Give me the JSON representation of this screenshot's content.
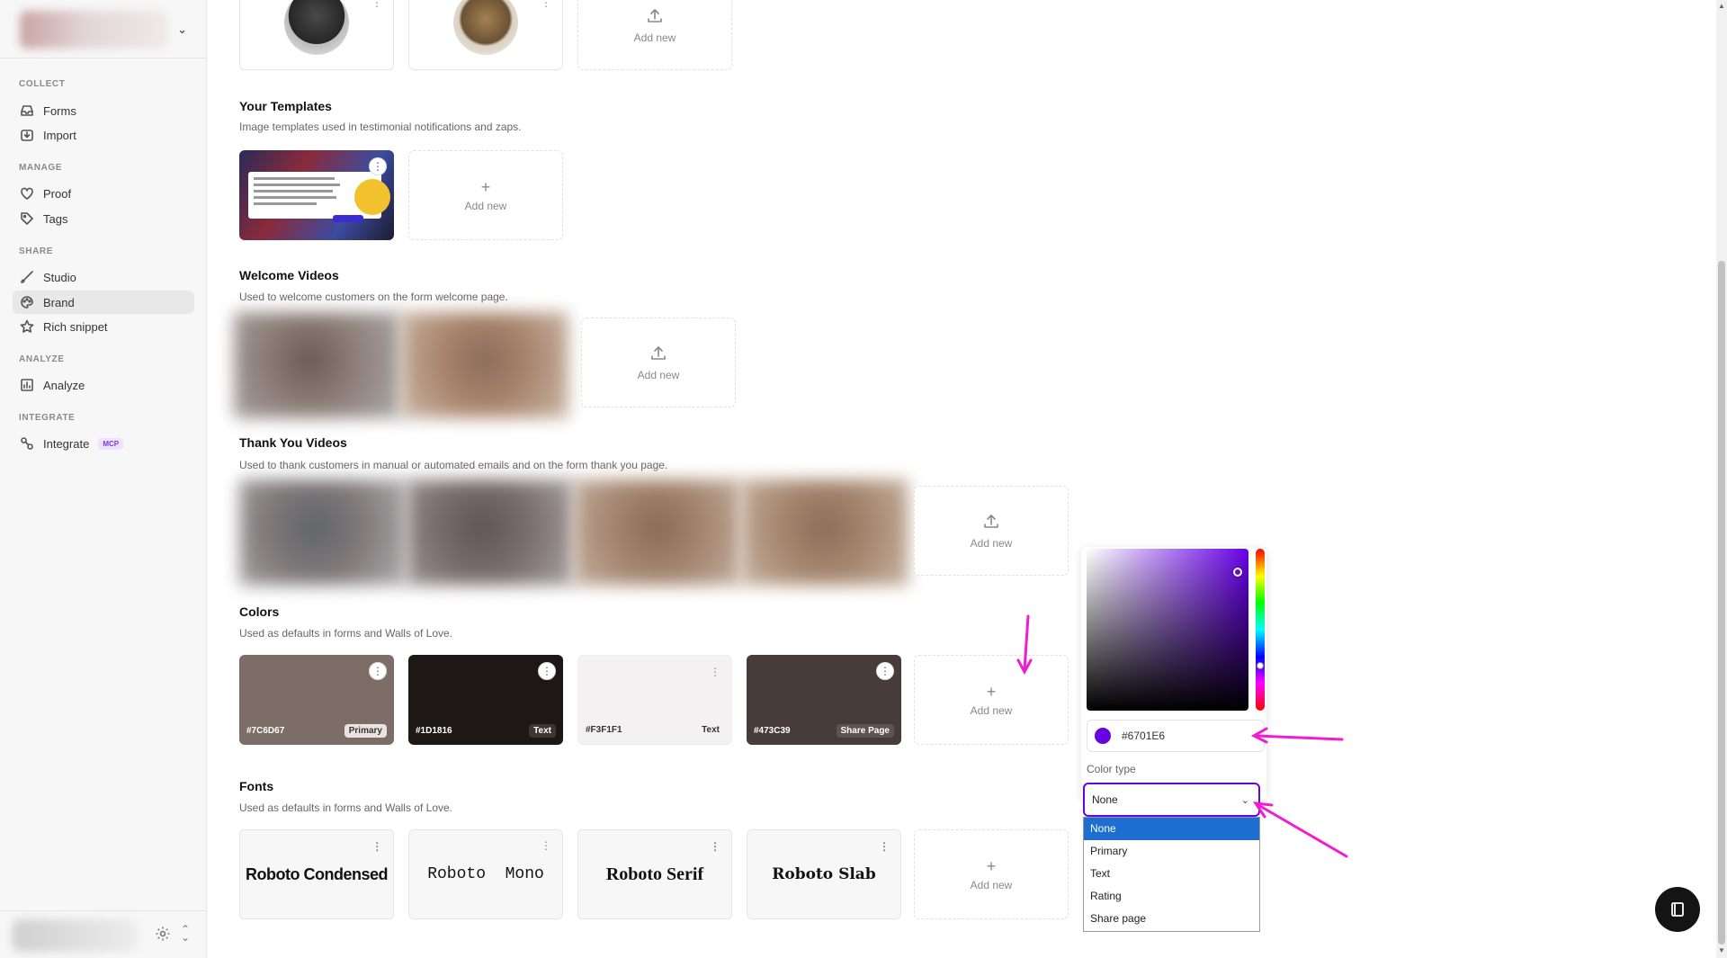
{
  "sidebar": {
    "sections": [
      {
        "label": "COLLECT",
        "items": [
          {
            "label": "Forms",
            "icon": "inbox-icon"
          },
          {
            "label": "Import",
            "icon": "import-icon"
          }
        ]
      },
      {
        "label": "MANAGE",
        "items": [
          {
            "label": "Proof",
            "icon": "heart-icon"
          },
          {
            "label": "Tags",
            "icon": "tag-icon"
          }
        ]
      },
      {
        "label": "SHARE",
        "items": [
          {
            "label": "Studio",
            "icon": "brush-icon"
          },
          {
            "label": "Brand",
            "icon": "palette-icon",
            "active": true
          },
          {
            "label": "Rich snippet",
            "icon": "star-icon"
          }
        ]
      },
      {
        "label": "ANALYZE",
        "items": [
          {
            "label": "Analyze",
            "icon": "chart-icon"
          }
        ]
      },
      {
        "label": "INTEGRATE",
        "items": [
          {
            "label": "Integrate",
            "icon": "plug-icon",
            "badge": "MCP"
          }
        ]
      }
    ]
  },
  "add_new_label": "Add new",
  "templates": {
    "title": "Your Templates",
    "subtitle": "Image templates used in testimonial notifications and zaps."
  },
  "welcome_videos": {
    "title": "Welcome Videos",
    "subtitle": "Used to welcome customers on the form welcome page."
  },
  "thank_you_videos": {
    "title": "Thank You Videos",
    "subtitle": "Used to thank customers in manual or automated emails and on the form thank you page."
  },
  "colors": {
    "title": "Colors",
    "subtitle": "Used as defaults in forms and Walls of Love.",
    "items": [
      {
        "hex": "#7C6D67",
        "type": "Primary",
        "bg": "#7c6d67",
        "fg": "#ffffff",
        "badge_bg": "#e9e4e2",
        "badge_fg": "#3a3330"
      },
      {
        "hex": "#1D1816",
        "type": "Text",
        "bg": "#1d1816",
        "fg": "#ffffff",
        "badge_bg": "#3c3532",
        "badge_fg": "#ffffff"
      },
      {
        "hex": "#F3F1F1",
        "type": "Text",
        "bg": "#f3f1f1",
        "fg": "#333333",
        "badge_bg": "#f3f1f1",
        "badge_fg": "#333333"
      },
      {
        "hex": "#473C39",
        "type": "Share Page",
        "bg": "#473c39",
        "fg": "#ffffff",
        "badge_bg": "#5e5350",
        "badge_fg": "#ffffff"
      }
    ]
  },
  "fonts": {
    "title": "Fonts",
    "subtitle": "Used as defaults in forms and Walls of Love.",
    "items": [
      "Roboto Condensed",
      "Roboto  Mono",
      "Roboto Serif",
      "Roboto Slab"
    ]
  },
  "picker": {
    "hex_value": "#6701E6",
    "color": "#6701e6",
    "color_type_label": "Color type",
    "selected": "None",
    "options": [
      "None",
      "Primary",
      "Text",
      "Rating",
      "Share page"
    ]
  },
  "annotation_color": "#f21bd0"
}
